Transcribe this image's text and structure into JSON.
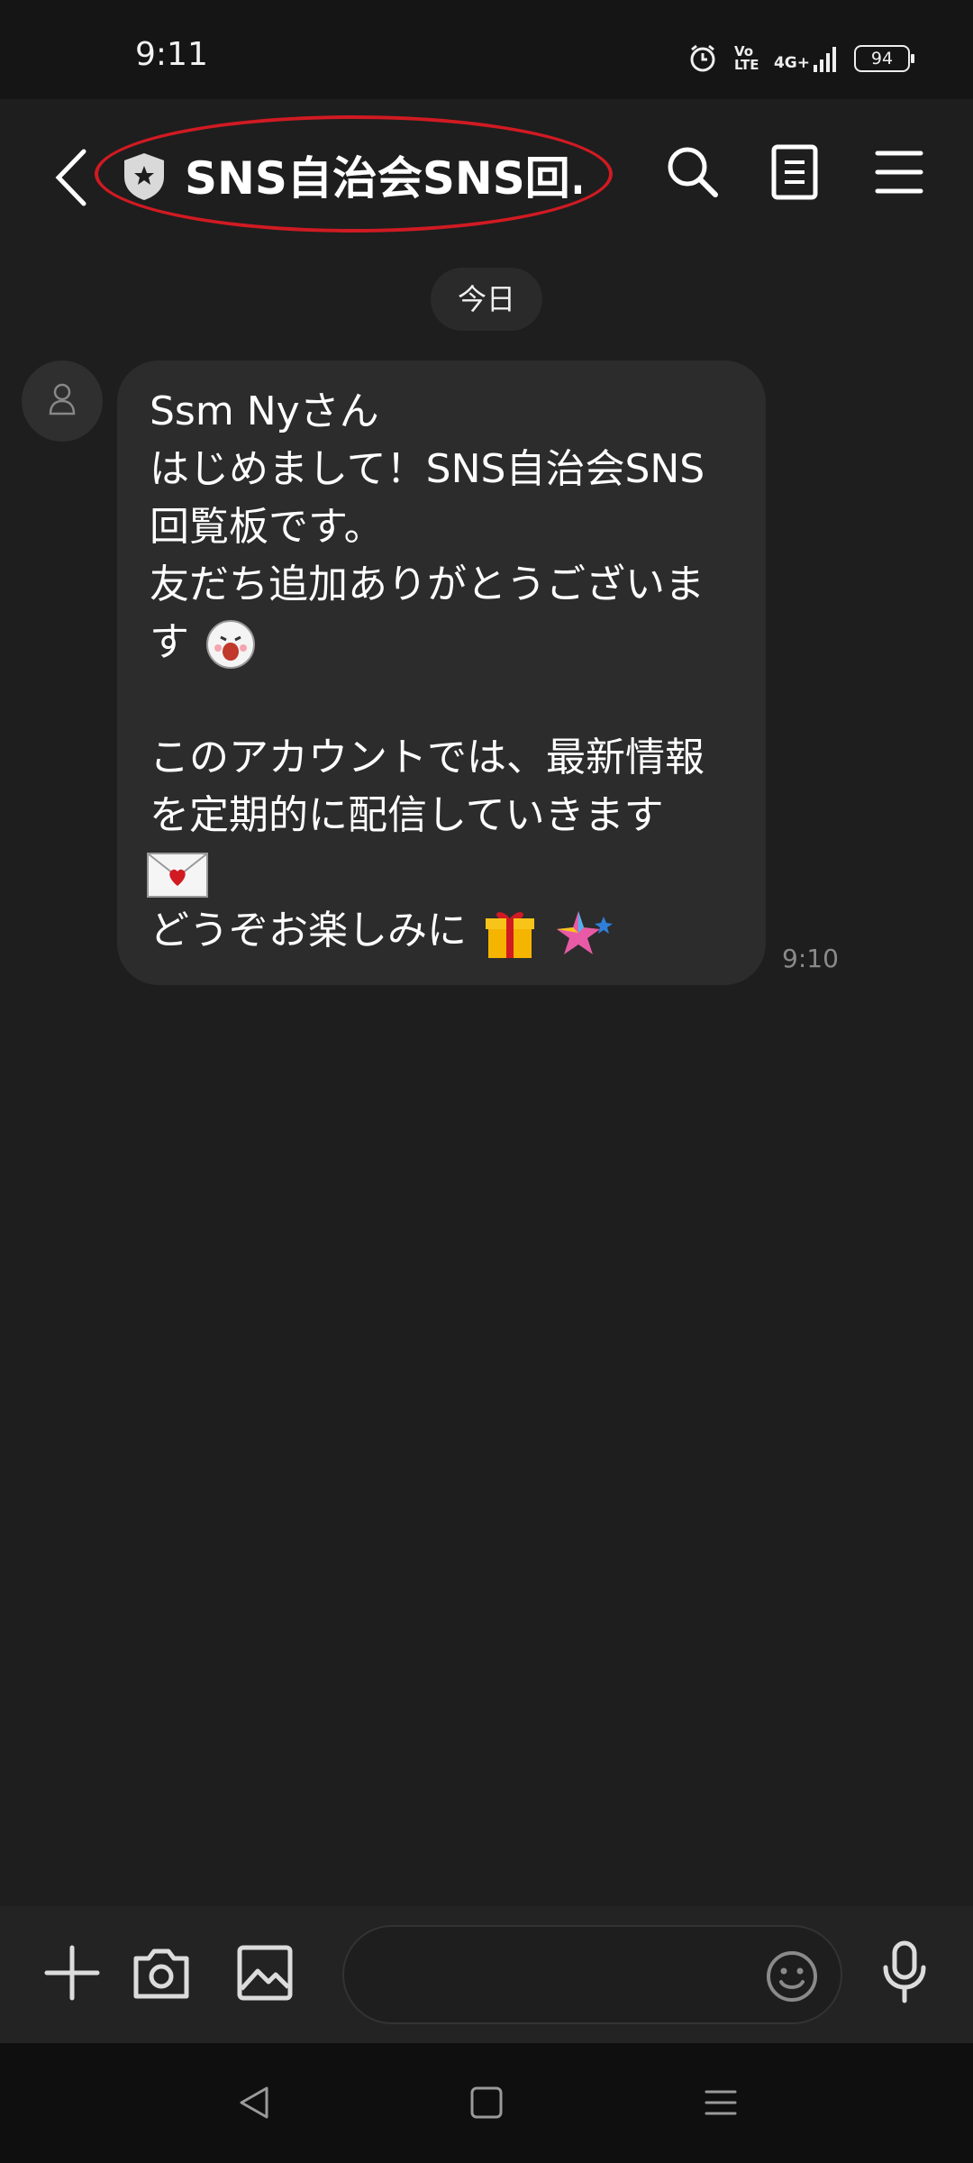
{
  "status_bar": {
    "time": "9:11",
    "network_label": "Vo LTE",
    "signal_label": "4G+",
    "battery": "94"
  },
  "header": {
    "title": "SNS自治会SNS回...",
    "back_icon": "chevron-left-icon",
    "account_badge_icon": "shield-star-icon",
    "search_icon": "search-icon",
    "notes_icon": "document-icon",
    "menu_icon": "hamburger-menu-icon",
    "highlight_color": "#d11a22"
  },
  "chat": {
    "date_separator": "今日",
    "messages": [
      {
        "lines": [
          "Ssm Nyさん",
          "はじめまして！SNS自治会SNS",
          "回覧板です。",
          "友だち追加ありがとうございま",
          "す",
          "",
          "このアカウントでは、最新情報",
          "を定期的に配信していきます",
          "",
          "どうぞお楽しみに"
        ],
        "time": "9:10"
      }
    ]
  },
  "input_bar": {
    "placeholder": "",
    "add_icon": "plus-icon",
    "camera_icon": "camera-icon",
    "image_icon": "image-icon",
    "emoji_icon": "smiley-icon",
    "mic_icon": "microphone-icon"
  },
  "nav_bar": {
    "back_icon": "triangle-back-icon",
    "home_icon": "square-home-icon",
    "recents_icon": "lines-recents-icon"
  },
  "colors": {
    "background": "#1e1e1e",
    "bubble": "#2c2c2c",
    "status_bar": "#151515"
  }
}
